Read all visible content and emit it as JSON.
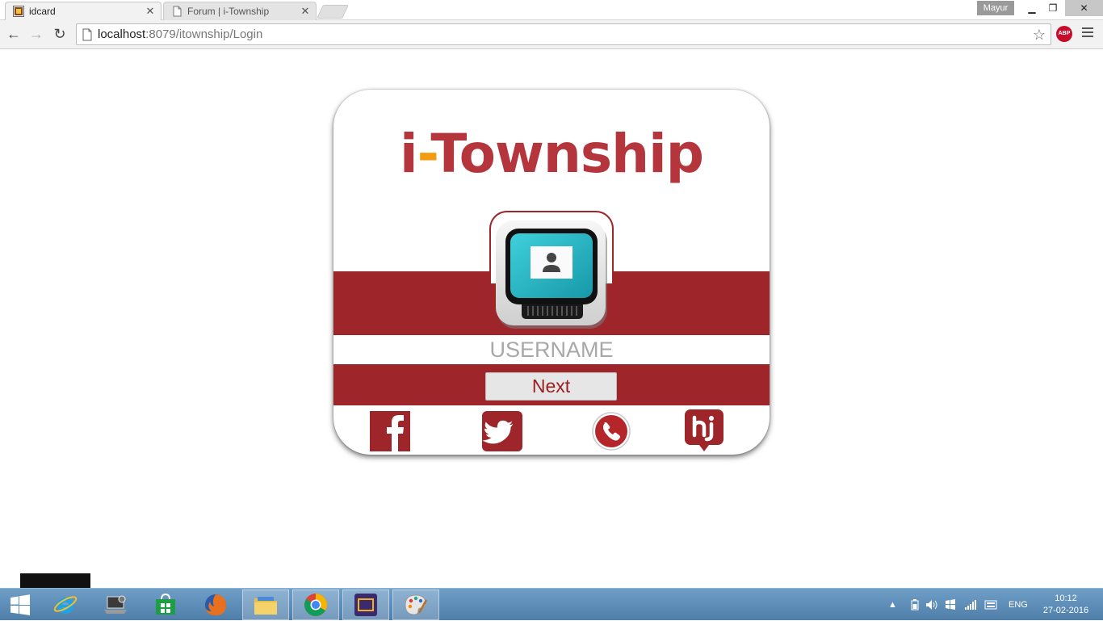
{
  "browser": {
    "tabs": [
      {
        "title": "idcard",
        "active": true
      },
      {
        "title": "Forum | i-Township",
        "active": false
      }
    ],
    "profile_name": "Mayur",
    "url_host": "localhost",
    "url_rest": ":8079/itownship/Login",
    "extension_badge": "ABP"
  },
  "login": {
    "brand_prefix": "i",
    "brand_dash": "-",
    "brand_name": "Township",
    "username_placeholder": "USERNAME",
    "next_label": "Next"
  },
  "social_links": [
    "facebook-icon",
    "twitter-icon",
    "whatsapp-icon",
    "hike-icon"
  ],
  "taskbar": {
    "apps": [
      "windows-start-icon",
      "internet-explorer-icon",
      "laptop-icon",
      "store-icon",
      "firefox-icon",
      "file-explorer-icon",
      "chrome-icon",
      "java-ee-ide-icon",
      "paint-icon"
    ],
    "language": "ENG",
    "time": "10:12",
    "date": "27-02-2016"
  },
  "colors": {
    "brand_red": "#b5353d",
    "band_red": "#9e2529",
    "brand_accent": "#f39c12",
    "taskbar_blue": "#5a88b3"
  }
}
